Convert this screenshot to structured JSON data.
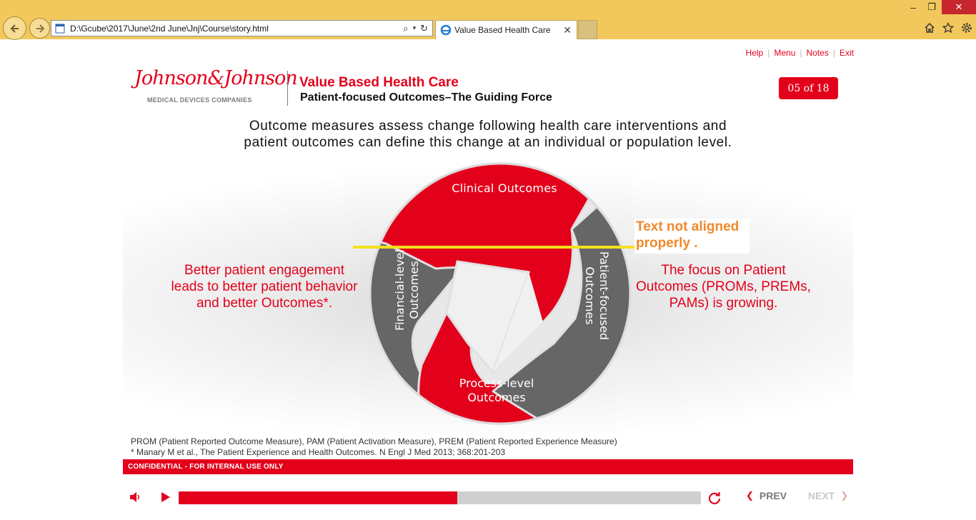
{
  "browser": {
    "address_url": "D:\\Gcube\\2017\\June\\2nd June\\Jnj\\Course\\story.html",
    "tab_title": "Value Based Health Care"
  },
  "header": {
    "links": [
      "Help",
      "Menu",
      "Notes",
      "Exit"
    ],
    "logo_script": "Johnson&Johnson",
    "logo_sub": "MEDICAL DEVICES COMPANIES",
    "course_title": "Value Based Health Care",
    "page_subtitle": "Patient-focused Outcomes–The Guiding Force",
    "page_counter": "05 of 18"
  },
  "slide": {
    "intro_line_1": "Outcome measures assess change following health care interventions and",
    "intro_line_2": "patient outcomes can define this change at an individual or population level.",
    "left_text": [
      "Better patient engagement",
      "leads to better patient behavior",
      "and better Outcomes*."
    ],
    "right_text": [
      "The focus on Patient",
      "Outcomes (PROMs, PREMs,",
      "PAMs) is growing."
    ],
    "diagram_segments": {
      "top": [
        "Clinical Outcomes"
      ],
      "right": [
        "Patient-focused",
        "Outcomes"
      ],
      "bottom": [
        "Process-level",
        "Outcomes"
      ],
      "left": [
        "Financial-level",
        "Outcomes"
      ]
    },
    "review_note": [
      "Text not aligned",
      "properly ."
    ],
    "footnote_1": "PROM (Patient Reported Outcome Measure), PAM (Patient Activation Measure), PREM (Patient Reported Experience Measure)",
    "footnote_2": "* Manary M et al., The Patient Experience and Health Outcomes. N Engl J Med 2013; 368:201-203",
    "confidential": "CONFIDENTIAL - FOR INTERNAL USE ONLY"
  },
  "player": {
    "progress_fraction": 0.533,
    "prev_label": "PREV",
    "next_label": "NEXT"
  },
  "colors": {
    "brand_red": "#e3001b",
    "segment_gray": "#666666",
    "chrome_gold": "#f2c85c",
    "annotation_orange": "#f0892a",
    "highlight_yellow": "#f5e21b"
  }
}
